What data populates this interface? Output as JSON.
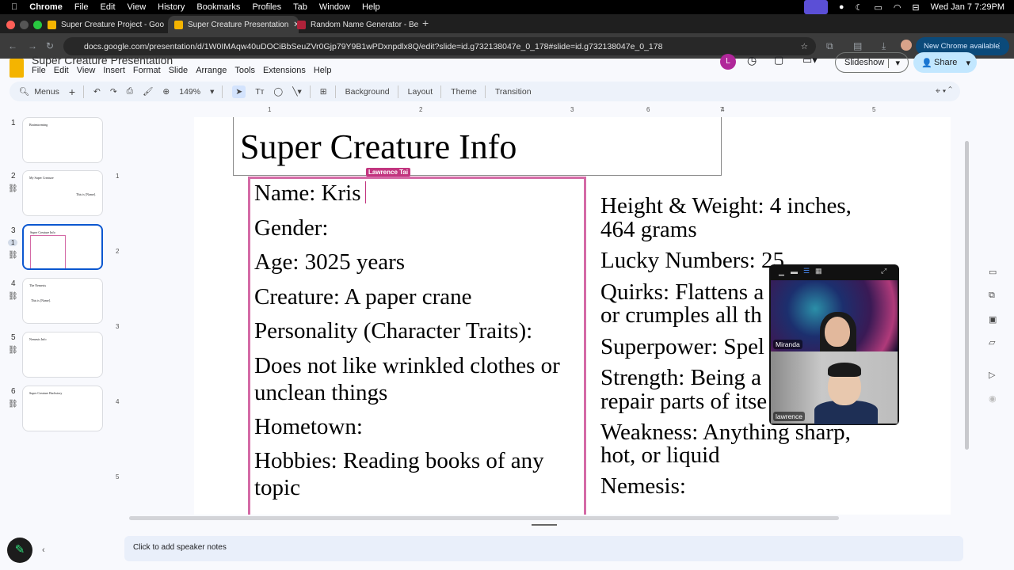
{
  "macos": {
    "app": "Chrome",
    "menus": [
      "File",
      "Edit",
      "View",
      "History",
      "Bookmarks",
      "Profiles",
      "Tab",
      "Window",
      "Help"
    ],
    "clock": "Wed Jan 7  7:29PM"
  },
  "browser": {
    "tabs": [
      {
        "title": "Super Creature Project - Goo",
        "active": false
      },
      {
        "title": "Super Creature Presentation",
        "active": true
      },
      {
        "title": "Random Name Generator - Be",
        "active": false
      }
    ],
    "url": "docs.google.com/presentation/d/1W0IMAqw40uDOCiBbSeuZVr0Gjp79Y9B1wPDxnpdlx8Q/edit?slide=id.g732138047e_0_178#slide=id.g732138047e_0_178",
    "update_label": "New Chrome available"
  },
  "app": {
    "doc_title": "Super Creature Presentation",
    "menus": [
      "File",
      "Edit",
      "View",
      "Insert",
      "Format",
      "Slide",
      "Arrange",
      "Tools",
      "Extensions",
      "Help"
    ],
    "slideshow_label": "Slideshow",
    "share_label": "Share",
    "user_initial": "L",
    "toolbar": {
      "search": "Menus",
      "zoom": "149%",
      "background": "Background",
      "layout": "Layout",
      "theme": "Theme",
      "transition": "Transition"
    },
    "ruler_h": [
      "1",
      "2",
      "3",
      "4",
      "5",
      "6",
      "7"
    ],
    "ruler_v": [
      "1",
      "2",
      "3",
      "4",
      "5"
    ],
    "speaker_notes": "Click to add speaker notes"
  },
  "filmstrip": [
    {
      "num": "1",
      "title": "Brainstorming",
      "linked": false,
      "selected": false
    },
    {
      "num": "2",
      "title": "My Super Creature",
      "body": "This is [Name].",
      "linked": true,
      "selected": false
    },
    {
      "num": "3",
      "title": "Super Creature Info",
      "linked": true,
      "selected": true,
      "viewers": "1"
    },
    {
      "num": "4",
      "title": "The Nemesis",
      "body": "This is [Name].",
      "linked": true,
      "selected": false
    },
    {
      "num": "5",
      "title": "Nemesis Info",
      "linked": true,
      "selected": false
    },
    {
      "num": "6",
      "title": "Super Creature Backstory",
      "linked": true,
      "selected": false
    }
  ],
  "slide": {
    "title": "Super Creature Info",
    "collaborator_cursor": "Lawrence Tai",
    "left": [
      "Name: Kris",
      "Gender:",
      "Age: 3025 years",
      "Creature: A paper crane",
      "Personality (Character Traits):",
      "Does not like wrinkled clothes or",
      "unclean things",
      "Hometown:",
      "Hobbies: Reading books of any",
      "topic"
    ],
    "right": [
      "Height & Weight: 4 inches,",
      "464 grams",
      "Lucky Numbers: 25",
      "Quirks: Flattens a",
      "or crumples all th",
      "Superpower: Spel",
      "Strength: Being a",
      "repair parts of itse",
      "Weakness: Anything sharp,",
      "hot, or liquid",
      "Nemesis:"
    ]
  },
  "video_call": {
    "participants": [
      "Miranda",
      "lawrence"
    ]
  },
  "colors": {
    "selection_border": "#d46aa6",
    "cursor_label": "#c2357f",
    "share_bg": "#c2e7ff",
    "accent": "#0b57d0"
  }
}
